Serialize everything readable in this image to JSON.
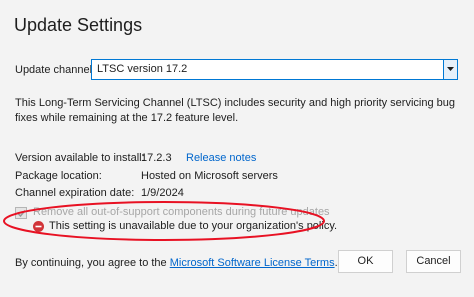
{
  "dialog": {
    "title": "Update Settings"
  },
  "channel": {
    "label": "Update channel:",
    "selected": "LTSC version 17.2"
  },
  "description": "This Long-Term Servicing Channel (LTSC) includes security and high priority servicing bug fixes while remaining at the 17.2 feature level.",
  "info": {
    "version_label": "Version available to install:",
    "version_value": "17.2.3",
    "release_notes": "Release notes",
    "package_label": "Package location:",
    "package_value": "Hosted on Microsoft servers",
    "expiration_label": "Channel expiration date:",
    "expiration_value": "1/9/2024"
  },
  "remove_checkbox": {
    "label": "Remove all out-of-support components during future updates",
    "checked": true
  },
  "policy_message": "This setting is unavailable due to your organization's policy.",
  "footer": {
    "prefix": "By continuing, you agree to the ",
    "license_link": "Microsoft Software License Terms",
    "suffix": "."
  },
  "buttons": {
    "ok": "OK",
    "cancel": "Cancel"
  },
  "colors": {
    "accent": "#0078d4",
    "link": "#0066cc",
    "error": "#d13438",
    "annotation": "#e81123"
  }
}
